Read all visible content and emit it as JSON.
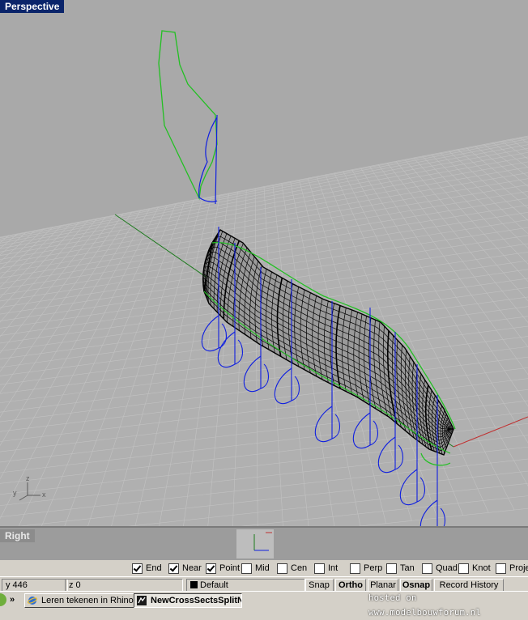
{
  "viewport": {
    "title": "Perspective",
    "axis_labels": {
      "x": "x",
      "y": "y",
      "z": "z"
    }
  },
  "right_viewport": {
    "title": "Right"
  },
  "osnap": {
    "items": [
      {
        "label": "End",
        "checked": true
      },
      {
        "label": "Near",
        "checked": true
      },
      {
        "label": "Point",
        "checked": true
      },
      {
        "label": "Mid",
        "checked": false
      },
      {
        "label": "Cen",
        "checked": false
      },
      {
        "label": "Int",
        "checked": false
      },
      {
        "label": "Perp",
        "checked": false
      },
      {
        "label": "Tan",
        "checked": false
      },
      {
        "label": "Quad",
        "checked": false
      },
      {
        "label": "Knot",
        "checked": false
      },
      {
        "label": "Project",
        "checked": false
      }
    ]
  },
  "status": {
    "y": "y 446",
    "z": "z 0",
    "layer": "Default",
    "buttons": [
      "Snap",
      "Ortho",
      "Planar",
      "Osnap",
      "Record History"
    ]
  },
  "taskbar": {
    "chevron": "»",
    "tasks": [
      {
        "label": "Leren tekenen in Rhino, ..."
      },
      {
        "label": "NewCrossSectsSplitN..."
      }
    ]
  },
  "watermark": "hosted on www.modelbouwforum.nl",
  "colors": {
    "viewport_bg": "#a9a9a9",
    "grid": "#b8b8b8",
    "title_bg": "#0a246a",
    "curve_green": "#22c022",
    "curve_blue": "#1020e0",
    "axis_red": "#c03030"
  }
}
